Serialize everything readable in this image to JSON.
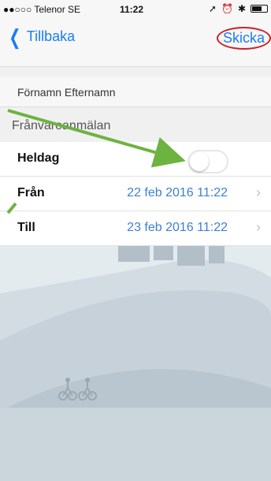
{
  "status_bar": {
    "carrier": "●●○○○ Telenor SE",
    "time": "11:22"
  },
  "nav": {
    "back_label": "Tillbaka",
    "send_label": "Skicka"
  },
  "user": {
    "name": "Förnamn Efternamn"
  },
  "section": {
    "title": "Frånvaroanmälan"
  },
  "rows": {
    "allday_label": "Heldag",
    "allday_toggle_on": false,
    "from_label": "Från",
    "from_value": "22 feb 2016  11:22",
    "to_label": "Till",
    "to_value": "23 feb 2016  11:22"
  },
  "colors": {
    "accent": "#1a7cf6",
    "annotation_arrow": "#6db33f",
    "annotation_circle": "#cc1f2a"
  }
}
